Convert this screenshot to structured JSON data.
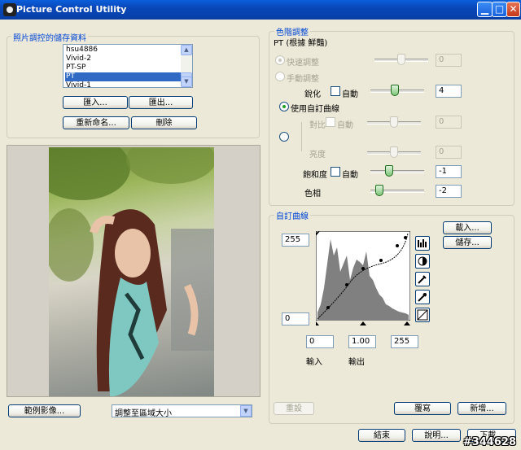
{
  "window": {
    "title": "Picture Control Utility"
  },
  "saved": {
    "legend": "照片調控的儲存資料",
    "items": [
      "hsu4886",
      "Vivid-2",
      "PT-SP",
      "PT",
      "Vivid-1"
    ],
    "selected_index": 3,
    "import_label": "匯入...",
    "export_label": "匯出...",
    "rename_label": "重新命名...",
    "delete_label": "刪除"
  },
  "preview": {
    "sample_button": "範例影像...",
    "fit_option": "調整至區域大小"
  },
  "tone": {
    "legend": "色階調整",
    "profile": "PT (根據 鮮豔)",
    "quick_label": "快速調整",
    "quick_value": "0",
    "manual_label": "手動調整",
    "sharpen_label": "銳化",
    "sharpen_auto": "自動",
    "sharpen_value": "4",
    "custom_curve_label": "使用自訂曲線",
    "contrast_label": "對比",
    "contrast_auto": "自動",
    "contrast_value": "0",
    "brightness_label": "亮度",
    "brightness_value": "0",
    "saturation_label": "飽和度",
    "saturation_auto": "自動",
    "saturation_value": "-1",
    "hue_label": "色相",
    "hue_value": "-2"
  },
  "curve": {
    "legend": "自訂曲線",
    "load_label": "載入...",
    "save_label": "儲存...",
    "output_max": "255",
    "output_min": "0",
    "input_black": "0",
    "gamma": "1.00",
    "input_white": "255",
    "input_label": "輸入",
    "output_label": "輸出",
    "reset_label": "重設",
    "overwrite_label": "覆寫",
    "new_label": "新增..."
  },
  "footer": {
    "close_label": "結束",
    "help_label": "說明...",
    "download_label": "下載..."
  },
  "watermark": "#344628"
}
